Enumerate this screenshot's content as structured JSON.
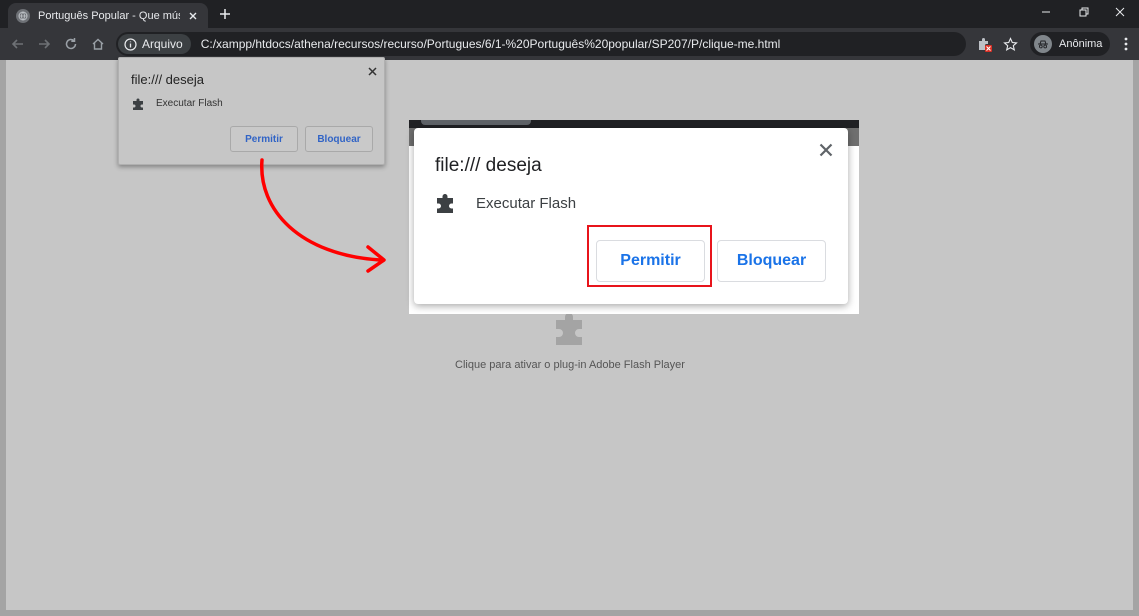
{
  "browser": {
    "tab_title": "Português Popular - Que música",
    "address_chip": "Arquivo",
    "url": "C:/xampp/htdocs/athena/recursos/recurso/Portugues/6/1-%20Português%20popular/SP207/P/clique-me.html",
    "profile_label": "Anônima"
  },
  "small_prompt": {
    "title": "file:/// deseja",
    "permission": "Executar Flash",
    "allow_label": "Permitir",
    "block_label": "Bloquear"
  },
  "zoomed_prompt": {
    "title": "file:/// deseja",
    "permission": "Executar Flash",
    "allow_label": "Permitir",
    "block_label": "Bloquear"
  },
  "page": {
    "plugin_message": "Clique para ativar o plug-in Adobe Flash Player"
  },
  "annotation": {
    "arrow_color": "#ff0000",
    "highlight_color": "#e8141b",
    "arrow_icon": "curved-arrow-icon"
  },
  "colors": {
    "accent_blue": "#1a73e8",
    "chrome_dark": "#202124",
    "toolbar": "#35363a",
    "page_bg": "#c6c6c6"
  }
}
